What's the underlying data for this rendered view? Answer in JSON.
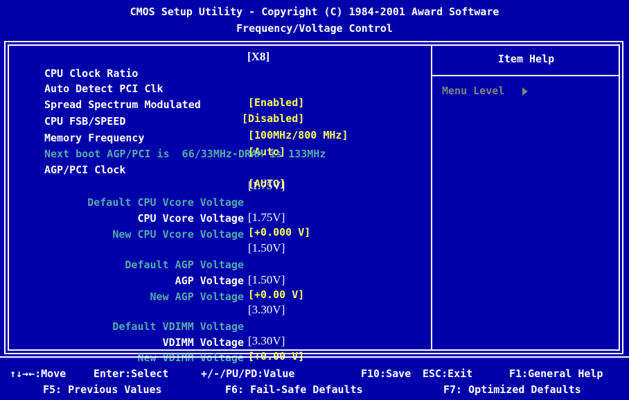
{
  "header": {
    "line1": "CMOS Setup Utility - Copyright (C) 1984-2001 Award Software",
    "line2": "Frequency/Voltage Control"
  },
  "settings": [
    {
      "label": "CPU Clock Ratio",
      "value": "[X8]"
    },
    {
      "label": "Auto Detect PCI Clk",
      "value": "[Enabled]"
    },
    {
      "label": "Spread Spectrum Modulated",
      "value": "[Disabled]"
    },
    {
      "label": "CPU FSB/SPEED",
      "value": "[100MHz/800 MHz]"
    },
    {
      "label": "Memory Frequency",
      "value": "[Auto]"
    },
    {
      "label": "Next boot AGP/PCI is  66/33MHz-DRAM is 133MHz"
    },
    {
      "label": "AGP/PCI Clock",
      "value": "[AUTO]"
    }
  ],
  "voltages": [
    {
      "label": "Default CPU Vcore Voltage",
      "value": "[1.75V]"
    },
    {
      "label": "CPU Vcore Voltage",
      "value": "[+0.000 V]"
    },
    {
      "label": "New CPU Vcore Voltage",
      "value": "[1.75V]"
    },
    {
      "label": "Default AGP Voltage",
      "value": "[1.50V]"
    },
    {
      "label": "AGP Voltage",
      "value": "[+0.00 V]"
    },
    {
      "label": "New AGP Voltage",
      "value": "[1.50V]"
    },
    {
      "label": "Default VDIMM Voltage",
      "value": "[3.30V]"
    },
    {
      "label": "VDIMM Voltage",
      "value": "[+0.00 V]"
    },
    {
      "label": "New VDIMM Voltage",
      "value": "[3.30V]"
    }
  ],
  "help": {
    "title": "Item Help",
    "menu_level": "Menu Level"
  },
  "footer": {
    "move": "↑↓→←:Move",
    "enter": "Enter:Select",
    "value": "+/-/PU/PD:Value",
    "save": "F10:Save",
    "exit": "ESC:Exit",
    "help": "F1:General Help",
    "previous": "F5: Previous Values",
    "failsafe": "F6: Fail-Safe Defaults",
    "optimized": "F7: Optimized Defaults"
  },
  "colors": {
    "background": "#0000aa",
    "text": "#ffffff",
    "selected_value": "#ffff55",
    "info_text": "#55aaaa",
    "disabled_text": "#808080"
  }
}
